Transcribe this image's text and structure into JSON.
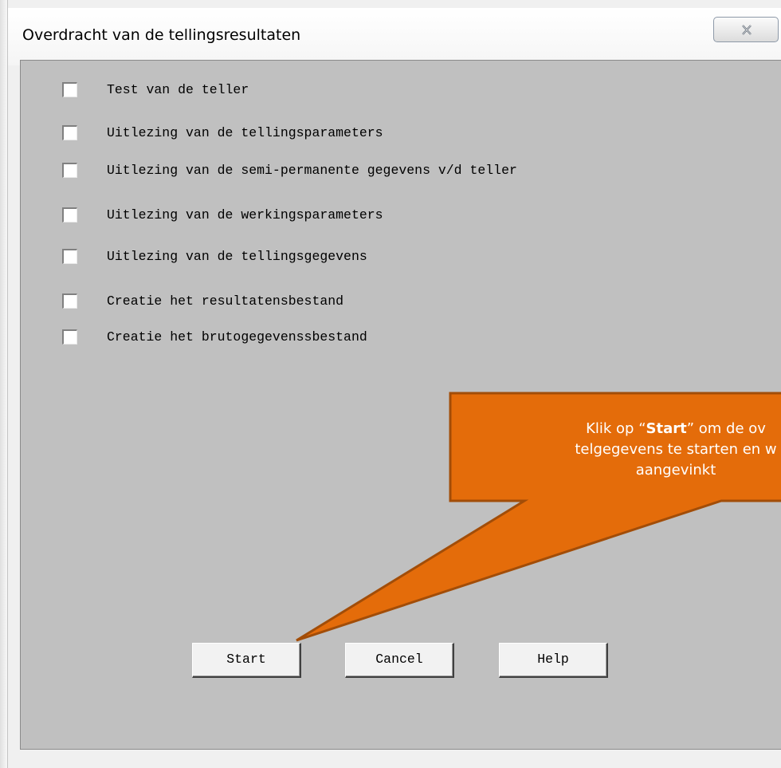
{
  "window": {
    "title": "Overdracht van de tellingsresultaten",
    "close_icon": "close-icon"
  },
  "options": [
    {
      "label": "Test van de teller",
      "checked": false
    },
    {
      "label": "Uitlezing van de tellingsparameters",
      "checked": false
    },
    {
      "label": "Uitlezing van de semi-permanente gegevens v/d teller",
      "checked": false
    },
    {
      "label": "Uitlezing van de werkingsparameters",
      "checked": false
    },
    {
      "label": "Uitlezing van de tellingsgegevens",
      "checked": false
    },
    {
      "label": "Creatie het resultatensbestand",
      "checked": false
    },
    {
      "label": "Creatie het brutogegevenssbestand",
      "checked": false
    }
  ],
  "buttons": {
    "start": "Start",
    "cancel": "Cancel",
    "help": "Help"
  },
  "callout": {
    "line1_before": "Klik op “",
    "line1_bold": "Start",
    "line1_after": "” om de ov",
    "line2": "telgegevens te starten en w",
    "line3": "aangevinkt",
    "fill_color": "#e46c0a",
    "border_color": "#a24d08"
  },
  "colors": {
    "dialog_background": "#c0c0c0",
    "titlebar": "#ffffff"
  }
}
